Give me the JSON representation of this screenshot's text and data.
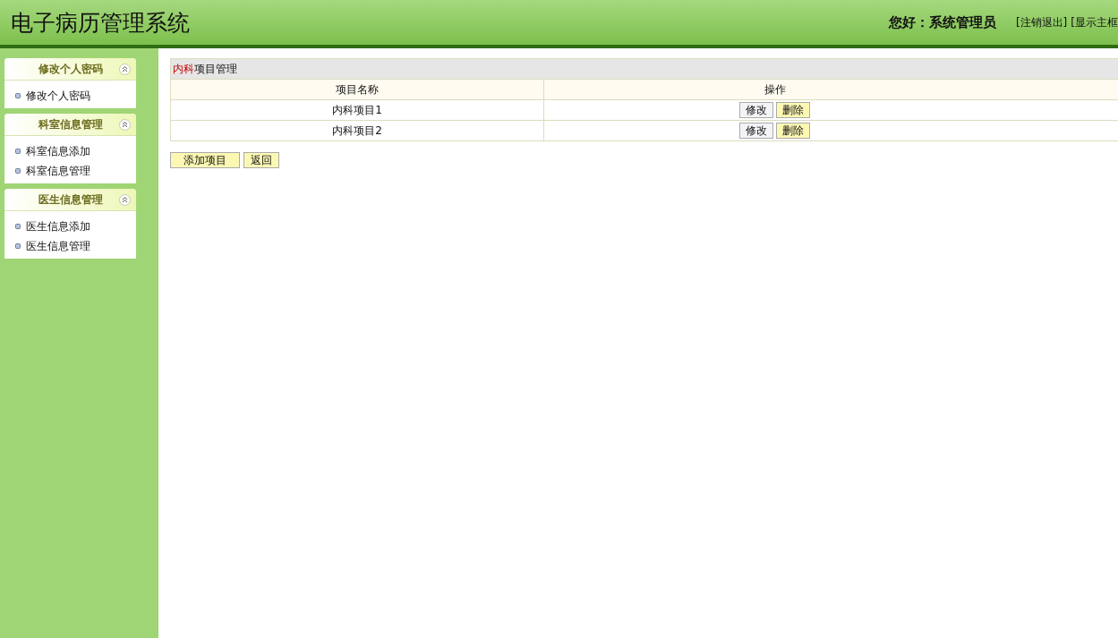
{
  "header": {
    "title": "电子病历管理系统",
    "greeting": "您好：系统管理员",
    "links": [
      "[注销退出]",
      "[显示主框"
    ]
  },
  "sidebar": {
    "panels": [
      {
        "title": "修改个人密码",
        "expanded": true,
        "items": [
          "修改个人密码"
        ]
      },
      {
        "title": "科室信息管理",
        "expanded": true,
        "items": [
          "科室信息添加",
          "科室信息管理"
        ]
      },
      {
        "title": "医生信息管理",
        "expanded": true,
        "items": [
          "医生信息添加",
          "医生信息管理"
        ]
      }
    ]
  },
  "table": {
    "title_highlight": "内科",
    "title_rest": "项目管理",
    "columns": [
      "项目名称",
      "操作"
    ],
    "rows": [
      {
        "name": "内科项目1",
        "actions": [
          "修改",
          "删除"
        ]
      },
      {
        "name": "内科项目2",
        "actions": [
          "修改",
          "删除"
        ]
      }
    ]
  },
  "buttons": [
    "添加项目",
    "返回"
  ]
}
